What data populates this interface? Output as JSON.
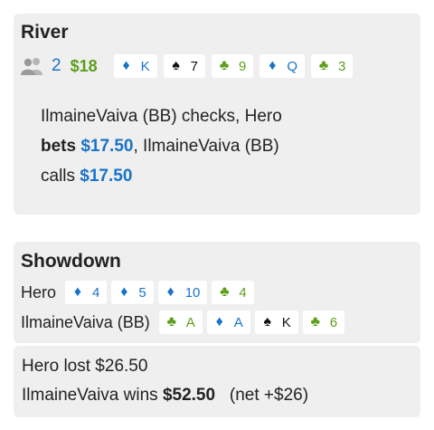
{
  "river": {
    "title": "River",
    "players_count": "2",
    "pot": "$18",
    "board": [
      {
        "suit": "diamond",
        "symbol": "♦",
        "rank": "K"
      },
      {
        "suit": "spade",
        "symbol": "♠",
        "rank": "7"
      },
      {
        "suit": "club",
        "symbol": "♣",
        "rank": "9"
      },
      {
        "suit": "diamond",
        "symbol": "♦",
        "rank": "Q"
      },
      {
        "suit": "club",
        "symbol": "♣",
        "rank": "3"
      }
    ],
    "action": {
      "p1": "IlmaineVaiva (BB) checks, Hero",
      "verb1": "bets",
      "amount1": "$17.50",
      "p2": ", IlmaineVaiva (BB)",
      "verb2": "calls",
      "amount2": "$17.50"
    }
  },
  "showdown": {
    "title": "Showdown",
    "hands": [
      {
        "name": "Hero",
        "cards": [
          {
            "suit": "diamond",
            "symbol": "♦",
            "rank": "4"
          },
          {
            "suit": "diamond",
            "symbol": "♦",
            "rank": "5"
          },
          {
            "suit": "diamond",
            "symbol": "♦",
            "rank": "10"
          },
          {
            "suit": "club",
            "symbol": "♣",
            "rank": "4"
          }
        ]
      },
      {
        "name": "IlmaineVaiva (BB)",
        "cards": [
          {
            "suit": "club",
            "symbol": "♣",
            "rank": "A"
          },
          {
            "suit": "diamond",
            "symbol": "♦",
            "rank": "A"
          },
          {
            "suit": "spade",
            "symbol": "♠",
            "rank": "K"
          },
          {
            "suit": "club",
            "symbol": "♣",
            "rank": "6"
          }
        ]
      }
    ]
  },
  "result": {
    "line1": "Hero lost $26.50",
    "line2_prefix": "IlmaineVaiva wins ",
    "line2_amount": "$52.50",
    "line2_net": "(net +$26)"
  },
  "colors": {
    "diamond": "#1a73c8",
    "club": "#5c9e1a",
    "spade": "#111111",
    "pot": "#5c9e1a",
    "amount": "#1a73c8",
    "panel": "#efefef"
  },
  "icons": {
    "players": "players-icon",
    "diamond": "diamond-suit-icon",
    "spade": "spade-suit-icon",
    "club": "club-suit-icon"
  }
}
